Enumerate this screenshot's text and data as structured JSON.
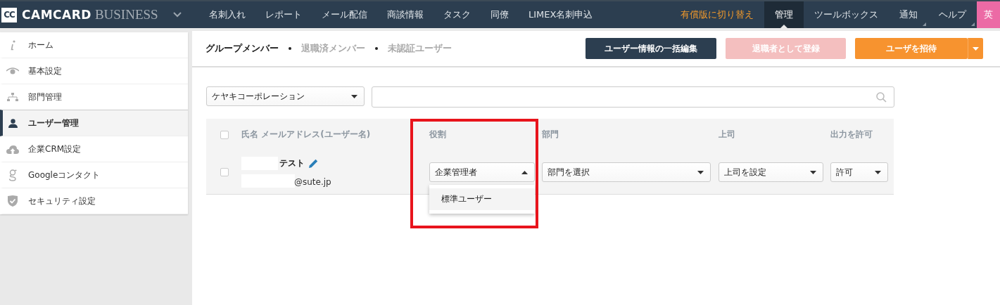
{
  "topbar": {
    "logo": {
      "badge": "CC",
      "name": "CAMCARD",
      "suffix": "BUSINESS"
    },
    "menu": [
      {
        "label": "名刺入れ"
      },
      {
        "label": "レポート"
      },
      {
        "label": "メール配信"
      },
      {
        "label": "商談情報"
      },
      {
        "label": "タスク"
      },
      {
        "label": "同僚"
      },
      {
        "label": "LIMEX名刺申込"
      }
    ],
    "right": [
      {
        "label": "有償版に切り替え",
        "kind": "upgrade",
        "selected": false
      },
      {
        "label": "管理",
        "kind": "tab",
        "selected": true
      },
      {
        "label": "ツールボックス",
        "kind": "tab",
        "selected": false
      },
      {
        "label": "通知",
        "kind": "dropdown",
        "selected": false
      },
      {
        "label": "ヘルプ",
        "kind": "dropdown",
        "selected": false
      },
      {
        "label": "英",
        "kind": "language",
        "selected": false
      }
    ]
  },
  "sidebar": {
    "items": [
      {
        "label": "ホーム",
        "kind": "info",
        "selected": false
      },
      {
        "label": "基本設定",
        "kind": "eye",
        "selected": false
      },
      {
        "label": "部門管理",
        "kind": "org",
        "selected": false
      },
      {
        "label": "ユーザー管理",
        "kind": "person",
        "selected": true
      },
      {
        "label": "企業CRM設定",
        "kind": "cloud",
        "selected": false
      },
      {
        "label": "Googleコンタクト",
        "kind": "google",
        "selected": false
      },
      {
        "label": "セキュリティ設定",
        "kind": "shield",
        "selected": false
      }
    ]
  },
  "tabs": [
    {
      "label": "グループメンバー",
      "selected": true
    },
    {
      "label": "退職済メンバー",
      "selected": false
    },
    {
      "label": "未認証ユーザー",
      "selected": false
    }
  ],
  "buttons": [
    {
      "label": "ユーザー情報の一括編集",
      "kind": "dark",
      "disabled": false
    },
    {
      "label": "退職者として登録",
      "kind": "danger",
      "disabled": true
    },
    {
      "label": "ユーザを招待",
      "kind": "accent",
      "disabled": false
    }
  ],
  "filter": {
    "company": "ケヤキコーポレーション"
  },
  "table": {
    "select_all_checked": false,
    "columns": [
      "氏名 メールアドレス(ユーザー名)",
      "役割",
      "部門",
      "上司",
      "出力を許可"
    ],
    "rows": [
      {
        "checked": false,
        "name": "テスト",
        "email": "@sute.jp",
        "role": "企業管理者",
        "role_expanded": true,
        "role_options": [
          "標準ユーザー"
        ],
        "department": "部門を選択",
        "manager": "上司を設定",
        "export": "許可"
      }
    ]
  },
  "annotation": {
    "kind": "highlight",
    "color": "#e8141c"
  }
}
